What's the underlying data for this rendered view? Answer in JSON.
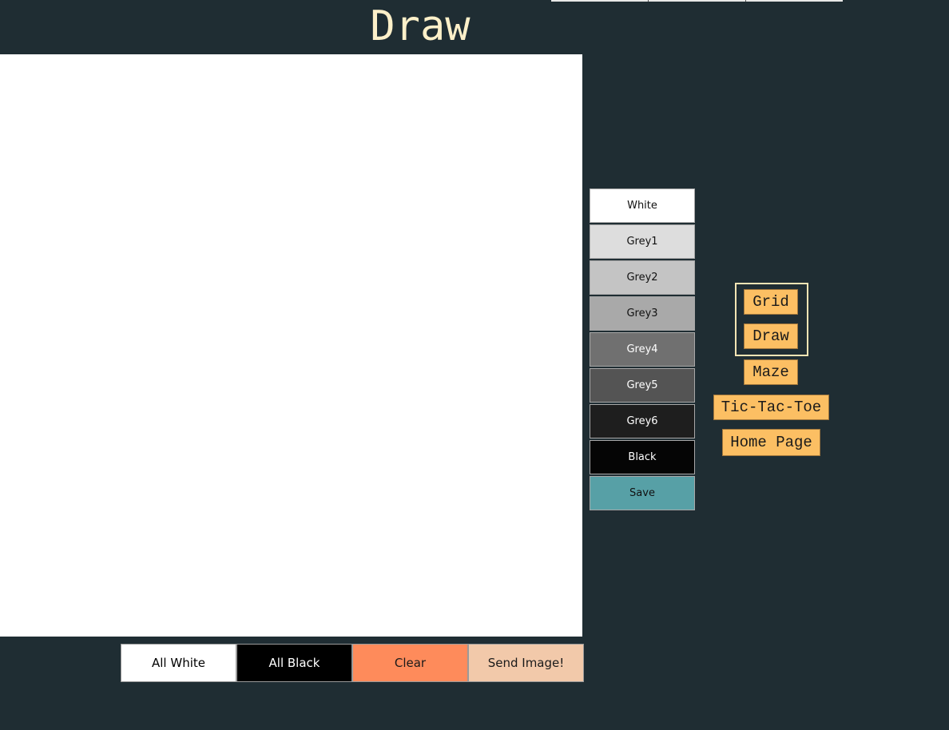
{
  "header": {
    "title": "Draw"
  },
  "canvas": {
    "background": "#ffffff"
  },
  "bottom_bar": {
    "buttons": [
      {
        "label": "All White",
        "bg": "#ffffff",
        "fg": "#000000"
      },
      {
        "label": "All Black",
        "bg": "#000000",
        "fg": "#ffffff"
      },
      {
        "label": "Clear",
        "bg": "#fe8b5b",
        "fg": "#1a1a1a"
      },
      {
        "label": "Send Image!",
        "bg": "#f2c9aa",
        "fg": "#1a1a1a"
      }
    ]
  },
  "palette": {
    "swatches": [
      {
        "label": "White",
        "bg": "#ffffff",
        "fg": "#111111"
      },
      {
        "label": "Grey1",
        "bg": "#dddddd",
        "fg": "#111111"
      },
      {
        "label": "Grey2",
        "bg": "#c4c4c4",
        "fg": "#111111"
      },
      {
        "label": "Grey3",
        "bg": "#a9a9a9",
        "fg": "#111111"
      },
      {
        "label": "Grey4",
        "bg": "#707070",
        "fg": "#ffffff"
      },
      {
        "label": "Grey5",
        "bg": "#545454",
        "fg": "#ffffff"
      },
      {
        "label": "Grey6",
        "bg": "#1e1e1e",
        "fg": "#ffffff"
      },
      {
        "label": "Black",
        "bg": "#050505",
        "fg": "#ffffff"
      },
      {
        "label": "Save",
        "bg": "#57a0a6",
        "fg": "#111111"
      }
    ]
  },
  "nav": {
    "grid": "Grid",
    "draw": "Draw",
    "maze": "Maze",
    "tictactoe": "Tic-Tac-Toe",
    "home": "Home Page"
  },
  "colors": {
    "background": "#1f2d33",
    "title": "#fdf0c9",
    "nav_button": "#fcbf63",
    "nav_group_border": "#f7e4b4"
  }
}
